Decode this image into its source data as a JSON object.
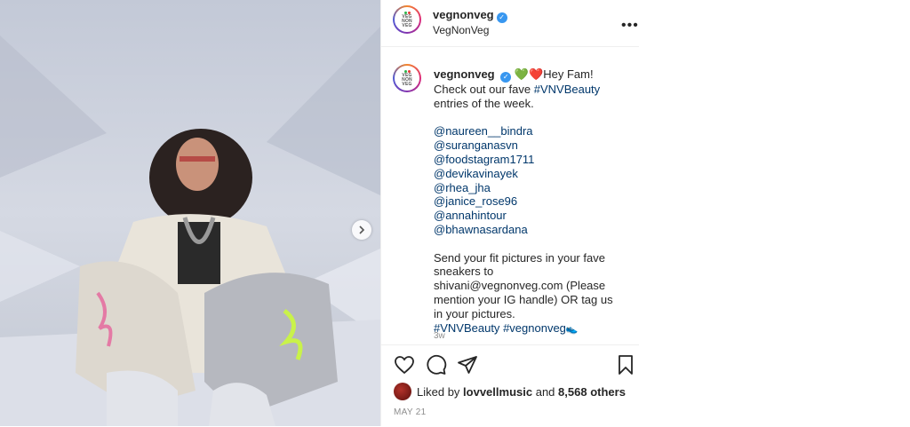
{
  "post": {
    "photo_alt": "",
    "header": {
      "username": "vegnonveg",
      "subtitle": "VegNonVeg",
      "avatar_text": [
        "VEG",
        "NON",
        "VEG"
      ],
      "more_icon": "more-horizontal-icon"
    },
    "caption": {
      "username": "vegnonveg",
      "emoji": [
        "💚",
        "❤️"
      ],
      "intro": "Hey Fam! Check out our fave ",
      "intro_tag": "#VNVBeauty",
      "intro_end": " entries of the week.",
      "mentions": [
        "@naureen__bindra",
        "@suranganasvn",
        "@foodstagram1711",
        "@devikavinayek",
        "@rhea_jha",
        "@janice_rose96",
        "@annahintour",
        "@bhawnasardana"
      ],
      "body": "Send your fit pictures in your fave sneakers to shivani@vegnonveg.com (Please mention your IG handle) OR tag us in your pictures.",
      "tags": [
        "#VNVBeauty",
        "#vegnonveg"
      ],
      "tail_emoji": "👟"
    },
    "age": "3w",
    "likes": {
      "prefix": "Liked by ",
      "by": "lovvellmusic",
      "middle": " and ",
      "count": "8,568 others"
    },
    "date": "MAY 21"
  },
  "colors": {
    "link": "#00376b",
    "verified": "#3897f0",
    "muted": "#8e8e8e"
  }
}
